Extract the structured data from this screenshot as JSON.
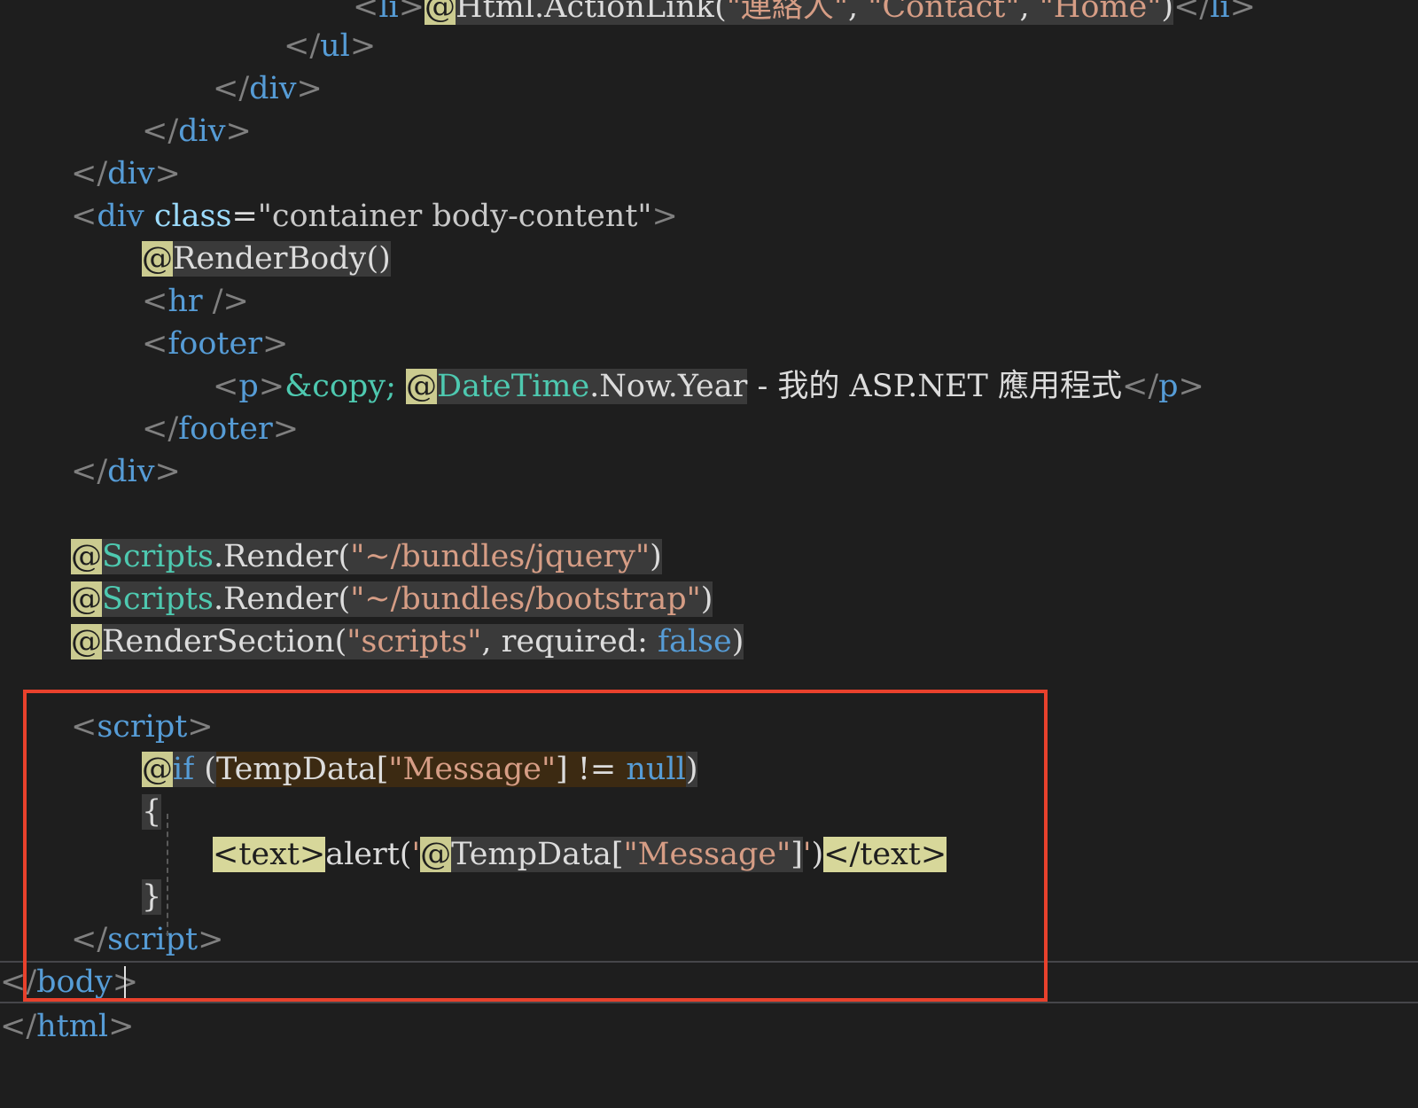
{
  "editor": {
    "accent_colors": {
      "tag": "#569cd6",
      "type": "#4ec9b0",
      "string": "#d69d85",
      "razor_marker": "#cbcb90",
      "annotation_box": "#e8412c"
    },
    "lines": [
      {
        "tokens": [
          {
            "t": "<",
            "c": "d"
          },
          {
            "t": "li",
            "c": "t"
          },
          {
            "t": ">",
            "c": "d"
          },
          {
            "t": "@",
            "c": "y"
          },
          {
            "t": "Html",
            "c": "p gbg"
          },
          {
            "t": ".",
            "c": "p gbg"
          },
          {
            "t": "ActionLink",
            "c": "p gbg"
          },
          {
            "t": "(",
            "c": "p gbg"
          },
          {
            "t": "\"連絡人\"",
            "c": "s gbg"
          },
          {
            "t": ", ",
            "c": "p gbg"
          },
          {
            "t": "\"Contact\"",
            "c": "s gbg"
          },
          {
            "t": ", ",
            "c": "p gbg"
          },
          {
            "t": "\"Home\"",
            "c": "s gbg"
          },
          {
            "t": ")",
            "c": "p gbg"
          },
          {
            "t": "</",
            "c": "d"
          },
          {
            "t": "li",
            "c": "t"
          },
          {
            "t": ">",
            "c": "d"
          }
        ]
      },
      {
        "tokens": [
          {
            "t": "</",
            "c": "d"
          },
          {
            "t": "ul",
            "c": "t"
          },
          {
            "t": ">",
            "c": "d"
          }
        ]
      },
      {
        "tokens": [
          {
            "t": "</",
            "c": "d"
          },
          {
            "t": "div",
            "c": "t"
          },
          {
            "t": ">",
            "c": "d"
          }
        ]
      },
      {
        "tokens": [
          {
            "t": "</",
            "c": "d"
          },
          {
            "t": "div",
            "c": "t"
          },
          {
            "t": ">",
            "c": "d"
          }
        ]
      },
      {
        "tokens": [
          {
            "t": "</",
            "c": "d"
          },
          {
            "t": "div",
            "c": "t"
          },
          {
            "t": ">",
            "c": "d"
          }
        ]
      },
      {
        "tokens": [
          {
            "t": "<",
            "c": "d"
          },
          {
            "t": "div",
            "c": "t"
          },
          {
            "t": " ",
            "c": "p"
          },
          {
            "t": "class",
            "c": "a"
          },
          {
            "t": "=",
            "c": "p"
          },
          {
            "t": "\"container body-content\"",
            "c": "av"
          },
          {
            "t": ">",
            "c": "d"
          }
        ]
      },
      {
        "tokens": [
          {
            "t": "@",
            "c": "y"
          },
          {
            "t": "RenderBody",
            "c": "p gbg"
          },
          {
            "t": "()",
            "c": "p gbg"
          }
        ]
      },
      {
        "tokens": [
          {
            "t": "<",
            "c": "d"
          },
          {
            "t": "hr",
            "c": "t"
          },
          {
            "t": " />",
            "c": "d"
          }
        ]
      },
      {
        "tokens": [
          {
            "t": "<",
            "c": "d"
          },
          {
            "t": "footer",
            "c": "t"
          },
          {
            "t": ">",
            "c": "d"
          }
        ]
      },
      {
        "tokens": [
          {
            "t": "<",
            "c": "d"
          },
          {
            "t": "p",
            "c": "t"
          },
          {
            "t": ">",
            "c": "d"
          },
          {
            "t": "&copy;",
            "c": "ent"
          },
          {
            "t": " ",
            "c": "p"
          },
          {
            "t": "@",
            "c": "y"
          },
          {
            "t": "DateTime",
            "c": "ty gbg"
          },
          {
            "t": ".Now.Year",
            "c": "p gbg"
          },
          {
            "t": " - 我的 ASP.NET 應用程式",
            "c": "p"
          },
          {
            "t": "</",
            "c": "d"
          },
          {
            "t": "p",
            "c": "t"
          },
          {
            "t": ">",
            "c": "d"
          }
        ]
      },
      {
        "tokens": [
          {
            "t": "</",
            "c": "d"
          },
          {
            "t": "footer",
            "c": "t"
          },
          {
            "t": ">",
            "c": "d"
          }
        ]
      },
      {
        "tokens": [
          {
            "t": "</",
            "c": "d"
          },
          {
            "t": "div",
            "c": "t"
          },
          {
            "t": ">",
            "c": "d"
          }
        ]
      },
      {
        "tokens": []
      },
      {
        "tokens": [
          {
            "t": "@",
            "c": "y"
          },
          {
            "t": "Scripts",
            "c": "ty gbg"
          },
          {
            "t": ".Render(",
            "c": "p gbg"
          },
          {
            "t": "\"~/bundles/jquery\"",
            "c": "s gbg"
          },
          {
            "t": ")",
            "c": "p gbg"
          }
        ]
      },
      {
        "tokens": [
          {
            "t": "@",
            "c": "y"
          },
          {
            "t": "Scripts",
            "c": "ty gbg"
          },
          {
            "t": ".Render(",
            "c": "p gbg"
          },
          {
            "t": "\"~/bundles/bootstrap\"",
            "c": "s gbg"
          },
          {
            "t": ")",
            "c": "p gbg"
          }
        ]
      },
      {
        "tokens": [
          {
            "t": "@",
            "c": "y"
          },
          {
            "t": "RenderSection(",
            "c": "p gbg"
          },
          {
            "t": "\"scripts\"",
            "c": "s gbg"
          },
          {
            "t": ", required: ",
            "c": "p gbg"
          },
          {
            "t": "false",
            "c": "t gbg"
          },
          {
            "t": ")",
            "c": "p gbg"
          }
        ]
      },
      {
        "tokens": []
      },
      {
        "tokens": [
          {
            "t": "<",
            "c": "d"
          },
          {
            "t": "script",
            "c": "t"
          },
          {
            "t": ">",
            "c": "d"
          }
        ]
      },
      {
        "tokens": [
          {
            "t": "@",
            "c": "y"
          },
          {
            "t": "if",
            "c": "t gbg"
          },
          {
            "t": " (",
            "c": "p gbg"
          },
          {
            "t": "TempData[",
            "c": "p obg"
          },
          {
            "t": "\"Message\"",
            "c": "s obg"
          },
          {
            "t": "] != ",
            "c": "p obg"
          },
          {
            "t": "null",
            "c": "t obg"
          },
          {
            "t": ")",
            "c": "p gbg"
          }
        ]
      },
      {
        "tokens": [
          {
            "t": "{",
            "c": "p gbg"
          }
        ]
      },
      {
        "tokens": [
          {
            "t": "<text>",
            "c": "tbg"
          },
          {
            "t": "alert(",
            "c": "p"
          },
          {
            "t": "'",
            "c": "s"
          },
          {
            "t": "@",
            "c": "y"
          },
          {
            "t": "TempData[",
            "c": "p gbg"
          },
          {
            "t": "\"Message\"",
            "c": "s gbg"
          },
          {
            "t": "]",
            "c": "p gbg"
          },
          {
            "t": "'",
            "c": "s"
          },
          {
            "t": ")",
            "c": "p"
          },
          {
            "t": "</text>",
            "c": "tbg"
          }
        ]
      },
      {
        "tokens": [
          {
            "t": "}",
            "c": "p gbg"
          }
        ]
      },
      {
        "tokens": [
          {
            "t": "</",
            "c": "d"
          },
          {
            "t": "script",
            "c": "t"
          },
          {
            "t": ">",
            "c": "d"
          }
        ]
      },
      {
        "tokens": [
          {
            "t": "</",
            "c": "d"
          },
          {
            "t": "body",
            "c": "t"
          },
          {
            "t": ">",
            "c": "d"
          }
        ]
      },
      {
        "tokens": [
          {
            "t": "</",
            "c": "d"
          },
          {
            "t": "html",
            "c": "t"
          },
          {
            "t": ">",
            "c": "d"
          }
        ]
      }
    ]
  }
}
